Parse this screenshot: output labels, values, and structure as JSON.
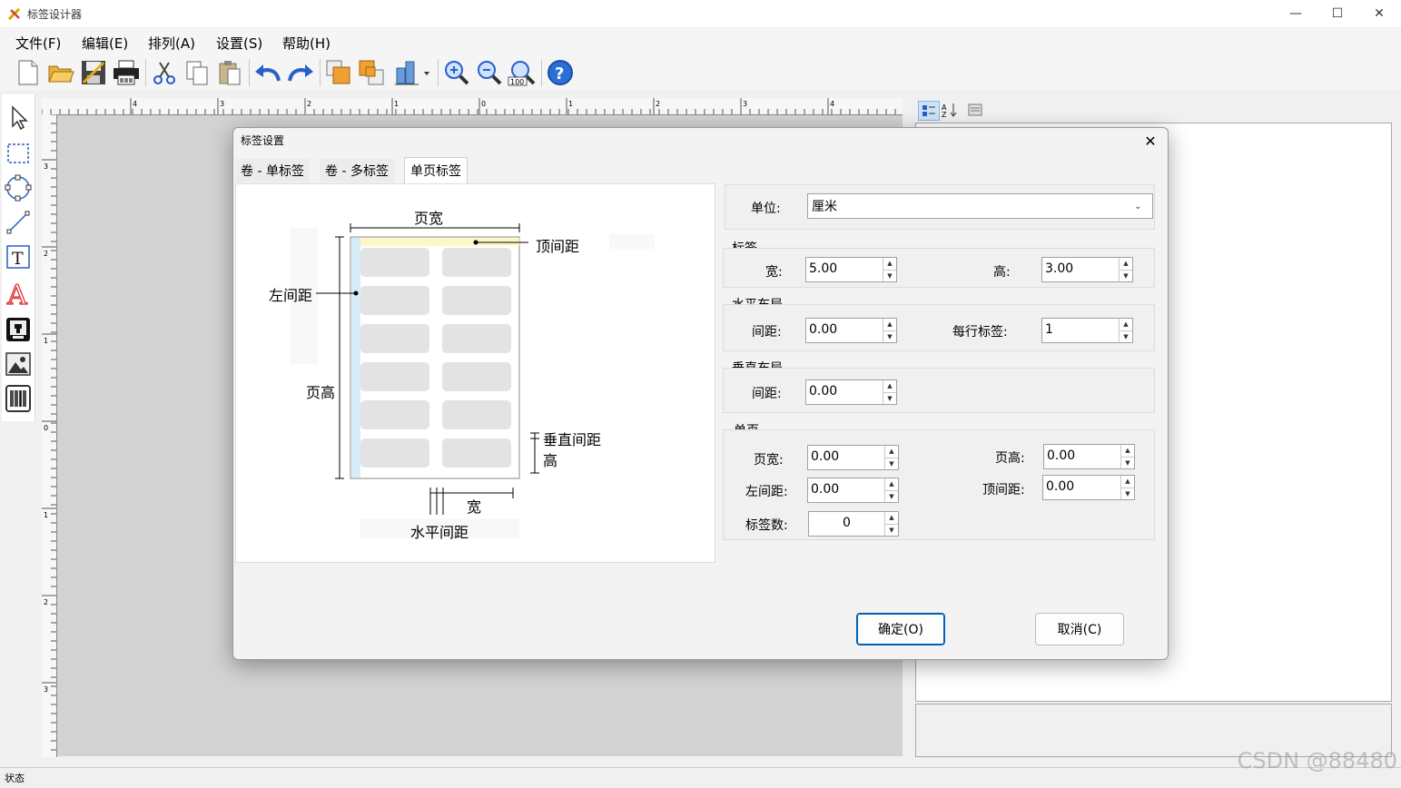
{
  "window": {
    "title": "标签设计器",
    "controls": {
      "minimize": "—",
      "maximize": "☐",
      "close": "✕"
    }
  },
  "menu": [
    "文件(F)",
    "编辑(E)",
    "排列(A)",
    "设置(S)",
    "帮助(H)"
  ],
  "toolbar": {
    "items": [
      "new-file-icon",
      "open-folder-icon",
      "save-icon",
      "print-icon",
      "cut-icon",
      "copy-icon",
      "paste-icon",
      "undo-icon",
      "redo-icon",
      "bring-front-icon",
      "send-back-icon",
      "align-icon",
      "zoom-in-icon",
      "zoom-out-icon",
      "zoom-100-icon",
      "help-icon"
    ],
    "zoom_label": "100",
    "help_glyph": "?"
  },
  "palette": [
    "pointer-icon",
    "rectangle-icon",
    "ellipse-icon",
    "line-icon",
    "text-box-icon",
    "text-art-icon",
    "stamp-icon",
    "image-icon",
    "barcode-icon"
  ],
  "palette_text": {
    "text_box": "T",
    "text_art": "A"
  },
  "ruler": {
    "h_labels": [
      "4",
      "3",
      "2",
      "1",
      "0",
      "1",
      "2",
      "3",
      "4"
    ],
    "v_labels": [
      "3",
      "2",
      "1",
      "0",
      "1",
      "2",
      "3"
    ]
  },
  "status": {
    "text": "状态"
  },
  "watermark": "CSDN @88480",
  "dialog": {
    "title": "标签设置",
    "close_glyph": "✕",
    "tabs": [
      "卷 - 单标签",
      "卷 - 多标签",
      "单页标签"
    ],
    "active_tab": 2,
    "preview": {
      "page_width": "页宽",
      "top_margin": "顶间距",
      "left_margin": "左间距",
      "page_height": "页高",
      "vertical_gap": "垂直间距",
      "height": "高",
      "width": "宽",
      "horizontal_gap": "水平间距"
    },
    "unit": {
      "label": "单位:",
      "value": "厘米"
    },
    "label_group": {
      "title": "标签",
      "width_label": "宽:",
      "width": "5.00",
      "height_label": "高:",
      "height": "3.00"
    },
    "h_layout": {
      "title": "水平布局",
      "gap_label": "间距:",
      "gap": "0.00",
      "per_row_label": "每行标签:",
      "per_row": "1"
    },
    "v_layout": {
      "title": "垂直布局",
      "gap_label": "间距:",
      "gap": "0.00"
    },
    "page": {
      "title": "单页",
      "page_width_label": "页宽:",
      "page_width": "0.00",
      "page_height_label": "页高:",
      "page_height": "0.00",
      "left_margin_label": "左间距:",
      "left_margin": "0.00",
      "top_margin_label": "顶间距:",
      "top_margin": "0.00",
      "count_label": "标签数:",
      "count": "0"
    },
    "ok": "确定(O)",
    "cancel": "取消(C)"
  },
  "colors": {
    "accent": "#005fb8",
    "canvas": "#d2d2d2",
    "label_cell": "#e3e3e3",
    "top_band": "#fdf7c8",
    "left_band": "#d6eefa"
  }
}
